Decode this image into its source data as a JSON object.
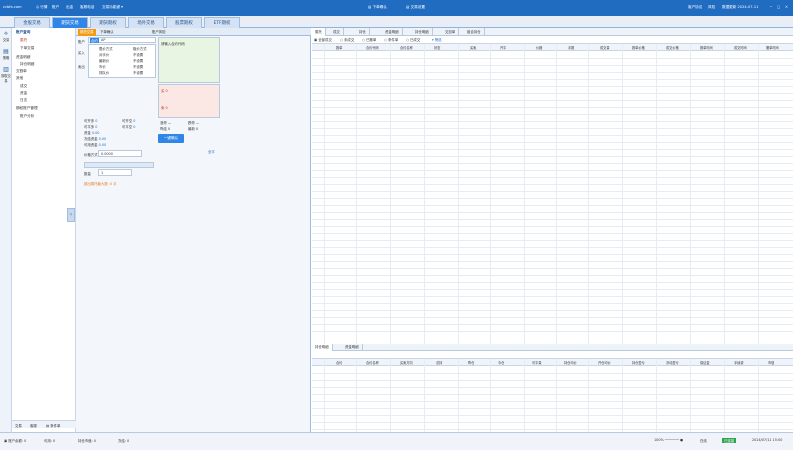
{
  "titlebar": {
    "left_items": [
      "ccbfa.com",
      "◎ 行情",
      "账户",
      "出金",
      "客服电话",
      "交易功能键 ▾"
    ],
    "center_items": [
      "▤ 下单确认",
      "▤ 交易设置"
    ],
    "right_items": [
      "客户协议",
      "风险",
      "数据更新 2024-07-11",
      "─",
      "□",
      "✕"
    ]
  },
  "nav": {
    "tabs": [
      "金股交易",
      "期货交易",
      "期货期权",
      "场外交易",
      "股票期权",
      "ETF期权"
    ],
    "active_index": 1
  },
  "iconbar": {
    "items": [
      {
        "icon": "⟡",
        "label": "交易"
      },
      {
        "icon": "▤",
        "label": "策略"
      },
      {
        "icon": "▥",
        "label": "期权交易"
      }
    ]
  },
  "tree": {
    "items": [
      "账户查询",
      "委托",
      "下单交易",
      "资金明细",
      "持仓明细",
      "交割单",
      "其他",
      "成交",
      "资金",
      "日志",
      "期权账户管理",
      "账户分析"
    ],
    "bottom_tabs": [
      "交易",
      "客服",
      "▤ 条件单"
    ]
  },
  "order": {
    "tabs": [
      "期货交易",
      "下单确认",
      "账户风险"
    ],
    "account_label": "账户",
    "contract_label": "合约",
    "contract_value": "AP",
    "side_labels": [
      "买入",
      "卖出"
    ],
    "price_types": [
      "限价方式",
      "对手价",
      "最新价",
      "市价",
      "排队价"
    ],
    "price_values": [
      "取价方式",
      "不设置",
      "不设置",
      "不设置",
      "不设置",
      "不设置"
    ],
    "green_title": "请输入合约代码",
    "pink_title": "卖 0",
    "buy_title": "买 0",
    "stats": [
      {
        "k": "可开多",
        "v": "0"
      },
      {
        "k": "可开空",
        "v": "0"
      },
      {
        "k": "可平多",
        "v": "0"
      },
      {
        "k": "可平空",
        "v": "0"
      },
      {
        "k": "资金",
        "v": "0.00"
      },
      {
        "k": "冻结资金",
        "v": "0.00"
      },
      {
        "k": "可用资金",
        "v": "0.00"
      }
    ],
    "right_stats": [
      {
        "k": "涨停",
        "v": "—"
      },
      {
        "k": "跌停",
        "v": "—"
      },
      {
        "k": "昨结",
        "v": "0"
      },
      {
        "k": "最新",
        "v": "0"
      }
    ],
    "submit_label": "一键确认",
    "volume_label": "数量",
    "volume_value": "1",
    "price_label": "价格方式",
    "price_value": "0.0000",
    "hint": "超出委托最大数: 0 手",
    "link": "全平"
  },
  "right": {
    "tabs": [
      "委托",
      "成交",
      "持仓",
      "资金明细",
      "持仓明细",
      "交割单",
      "组合持仓"
    ],
    "filter": [
      "▣ 全部成交",
      "○ 未成交",
      "○ 已撤单",
      "○ 条件单",
      "○ 已成交",
      "▾ 筛选"
    ],
    "columns": [
      "报单",
      "合约代码",
      "合约名称",
      "状态",
      "买卖",
      "开平",
      "价格",
      "手数",
      "成交量",
      "报单价格",
      "成交价格",
      "报单时间",
      "成交时间",
      "撤单时间"
    ],
    "bottom_tabs": [
      "持仓明细",
      "资金明细"
    ],
    "bottom_columns": [
      "合约",
      "合约名称",
      "买卖方向",
      "总持",
      "昨仓",
      "今仓",
      "可平量",
      "持仓均价",
      "开仓均价",
      "持仓盈亏",
      "浮动盈亏",
      "保证金",
      "手续费",
      "市值"
    ]
  },
  "status": {
    "left": [
      "▣ 账户余额: 0",
      "可用: 0",
      "持仓市值: 0",
      "冻结: 0"
    ],
    "right": [
      "100% ─────── ●",
      "在线",
      "已连接",
      "2024/07/11 15:00"
    ]
  }
}
